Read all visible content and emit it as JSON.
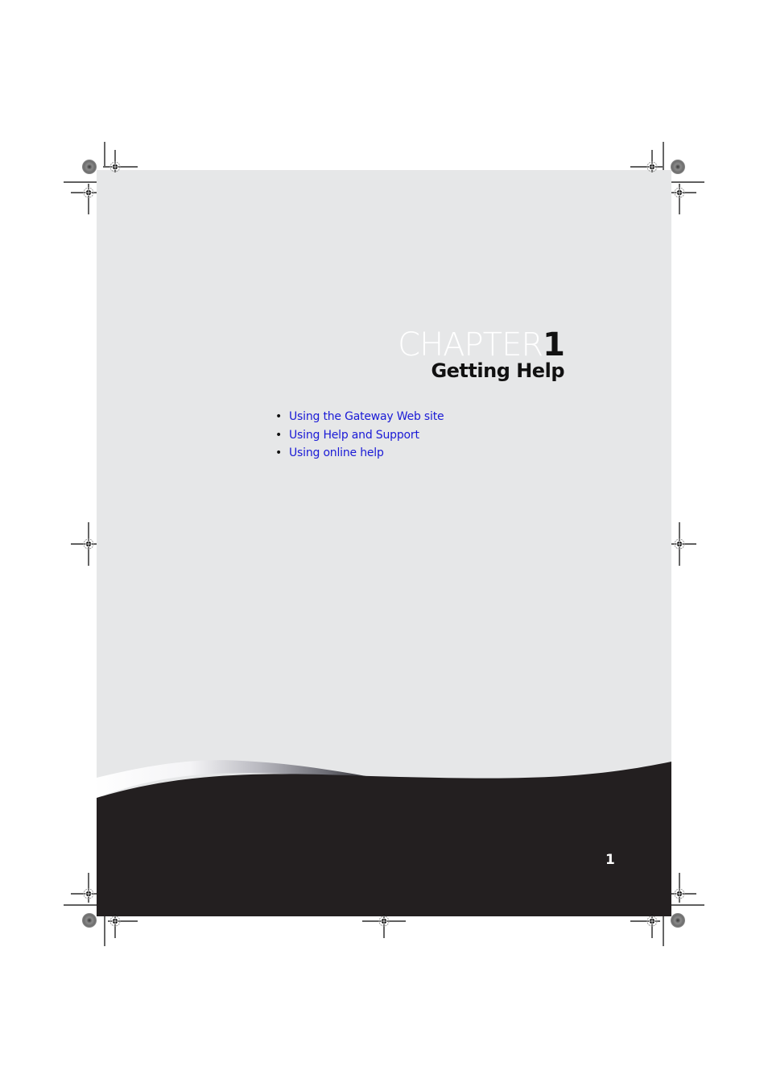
{
  "chapter": {
    "word": "CHAPTER",
    "number": "1",
    "title": "Getting Help"
  },
  "toc": {
    "bullet": "•",
    "items": [
      {
        "label": "Using the Gateway Web site"
      },
      {
        "label": "Using Help and Support"
      },
      {
        "label": "Using online help"
      }
    ]
  },
  "page_number": "1",
  "colors": {
    "page_background": "#e6e7e8",
    "footer_band": "#231f20",
    "link": "#1a1ad6"
  }
}
